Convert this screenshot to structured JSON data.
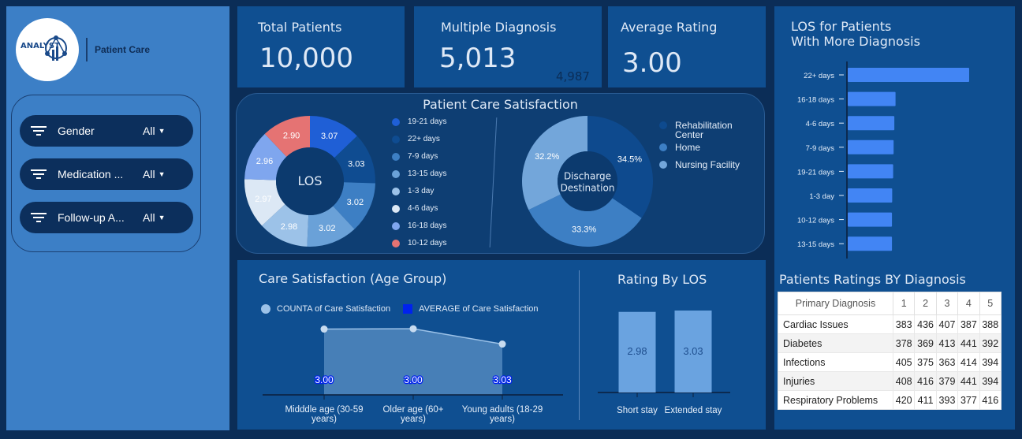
{
  "brand": {
    "logo_text": "ANALYST",
    "title": "Patient Care"
  },
  "filters": [
    {
      "label": "Gender",
      "value": "All"
    },
    {
      "label": "Medication ...",
      "value": "All"
    },
    {
      "label": "Follow-up A...",
      "value": "All"
    }
  ],
  "kpis": {
    "total_patients": {
      "title": "Total Patients",
      "value": "10,000"
    },
    "multiple_diagnosis": {
      "title": "Multiple Diagnosis",
      "value": "5,013",
      "secondary": "4,987"
    },
    "average_rating": {
      "title": "Average Rating",
      "value": "3.00"
    }
  },
  "satisfaction": {
    "title": "Patient Care Satisfaction",
    "los_center": "LOS",
    "discharge_center_line1": "Discharge",
    "discharge_center_line2": "Destination"
  },
  "colors": {
    "accent": "#4285f4",
    "panel": "#0f4f91",
    "background": "#0b2d57",
    "sidebar": "#3c7fc6"
  },
  "chart_data": [
    {
      "type": "pie",
      "title": "Patient Care Satisfaction",
      "center_label": "LOS",
      "categories": [
        "19-21 days",
        "22+ days",
        "7-9 days",
        "13-15 days",
        "1-3 day",
        "4-6 days",
        "16-18 days",
        "10-12 days"
      ],
      "values": [
        3.07,
        3.03,
        3.02,
        3.02,
        2.98,
        2.97,
        2.96,
        2.9
      ],
      "colors": [
        "#1f5fd6",
        "#0f4c91",
        "#3d7fc4",
        "#6aa1d8",
        "#9cc2e8",
        "#dce8f5",
        "#7fa6ee",
        "#e57373"
      ]
    },
    {
      "type": "pie",
      "center_label": "Discharge Destination",
      "categories": [
        "Rehabilitation Center",
        "Home",
        "Nursing Facility"
      ],
      "values": [
        34.5,
        33.3,
        32.2
      ],
      "labels": [
        "34.5%",
        "33.3%",
        "32.2%"
      ],
      "colors": [
        "#0e4a8e",
        "#3d7fc4",
        "#73a6da"
      ]
    },
    {
      "type": "bar",
      "title": "LOS for Patients With More Diagnosis",
      "title_line1": "LOS for Patients",
      "title_line2": "With More Diagnosis",
      "categories": [
        "22+ days",
        "16-18 days",
        "4-6 days",
        "7-9 days",
        "19-21 days",
        "1-3 day",
        "10-12 days",
        "13-15 days"
      ],
      "values": [
        508,
        200,
        195,
        192,
        190,
        186,
        185,
        185
      ],
      "color": "#4285f4"
    },
    {
      "type": "area",
      "title": "Care Satisfaction (Age Group)",
      "legend": [
        "COUNTA of Care Satisfaction",
        "AVERAGE of Care Satisfaction"
      ],
      "categories": [
        "Midddle age (30-59 years)",
        "Older age (60+ years)",
        "Young adults (18-29 years)"
      ],
      "series": [
        {
          "name": "COUNTA of Care Satisfaction",
          "values": [
            3600,
            3620,
            2780
          ]
        },
        {
          "name": "AVERAGE of Care Satisfaction",
          "values": [
            3.0,
            3.0,
            3.03
          ]
        }
      ],
      "labels": [
        "3.00",
        "3.00",
        "3.03"
      ]
    },
    {
      "type": "bar",
      "title": "Rating By LOS",
      "categories": [
        "Short stay",
        "Extended stay"
      ],
      "values": [
        2.98,
        3.03
      ],
      "labels": [
        "2.98",
        "3.03"
      ],
      "color": "#6aa3e0"
    },
    {
      "type": "table",
      "title": "Patients Ratings BY Diagnosis",
      "columns": [
        "Primary Diagnosis",
        "1",
        "2",
        "3",
        "4",
        "5"
      ],
      "rows": [
        [
          "Cardiac Issues",
          "383",
          "436",
          "407",
          "387",
          "388"
        ],
        [
          "Diabetes",
          "378",
          "369",
          "413",
          "441",
          "392"
        ],
        [
          "Infections",
          "405",
          "375",
          "363",
          "414",
          "394"
        ],
        [
          "Injuries",
          "408",
          "416",
          "379",
          "441",
          "394"
        ],
        [
          "Respiratory Problems",
          "420",
          "411",
          "393",
          "377",
          "416"
        ]
      ]
    }
  ]
}
